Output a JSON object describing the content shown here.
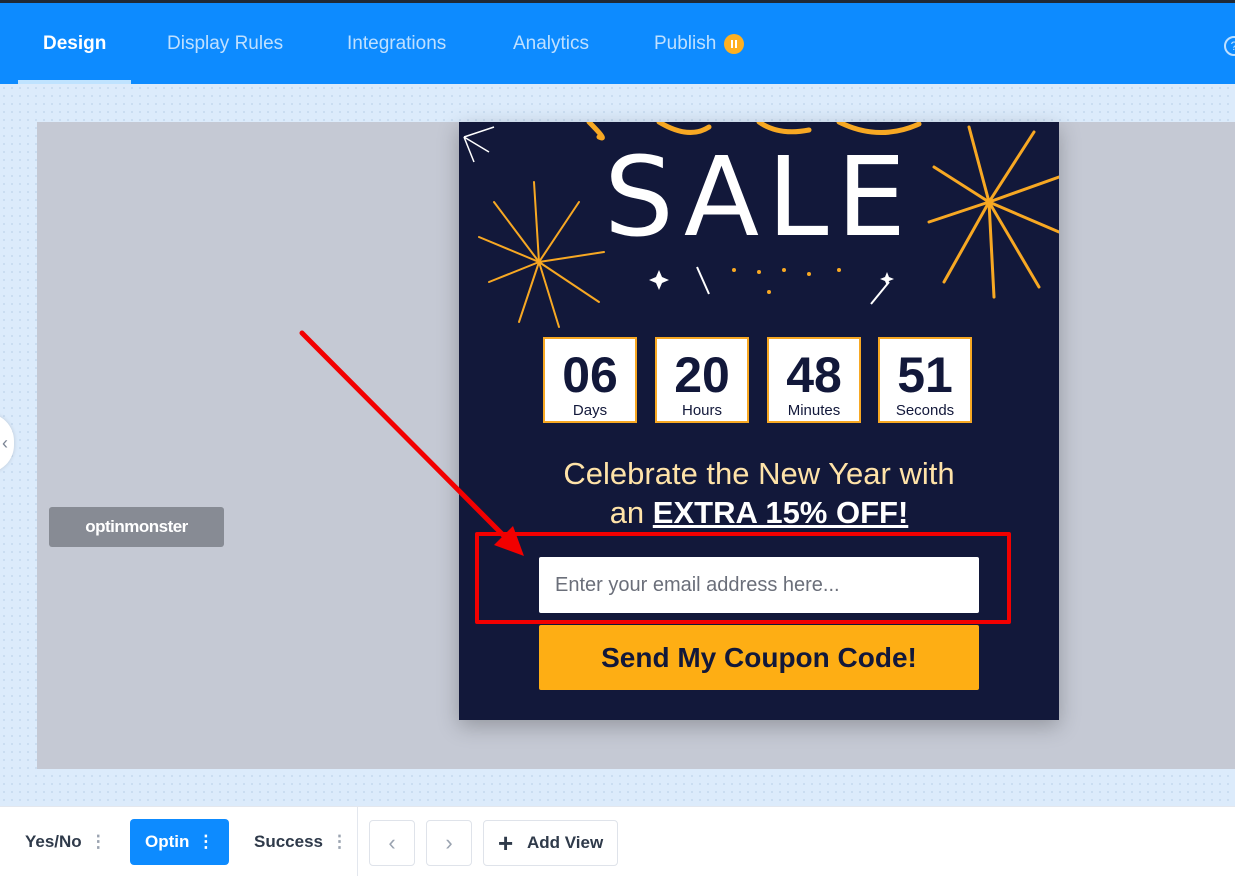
{
  "topbar": {
    "tabs": [
      {
        "label": "Design",
        "active": true
      },
      {
        "label": "Display Rules",
        "active": false
      },
      {
        "label": "Integrations",
        "active": false
      },
      {
        "label": "Analytics",
        "active": false
      },
      {
        "label": "Publish",
        "active": false
      }
    ],
    "publish_status_icon": "pause-icon",
    "help_icon": "help-icon",
    "help_glyph": "?"
  },
  "sidebar": {
    "collapse_icon": "chevron-left-icon",
    "collapse_glyph": "‹"
  },
  "branding": {
    "logo_text": "optinmonster"
  },
  "popup": {
    "headline_script": "New Year",
    "sale_text": "SALE",
    "countdown": [
      {
        "value": "06",
        "label": "Days"
      },
      {
        "value": "20",
        "label": "Hours"
      },
      {
        "value": "48",
        "label": "Minutes"
      },
      {
        "value": "51",
        "label": "Seconds"
      }
    ],
    "headline_line1": "Celebrate the New Year with",
    "headline_line2_prefix": "an ",
    "headline_line2_strong": "EXTRA 15% OFF!",
    "email_placeholder": "Enter your email address here...",
    "button_label": "Send My Coupon Code!"
  },
  "annotation": {
    "color": "#f20000"
  },
  "bottombar": {
    "views": [
      {
        "label": "Yes/No",
        "active": false
      },
      {
        "label": "Optin",
        "active": true
      },
      {
        "label": "Success",
        "active": false
      }
    ],
    "dots_glyph": "⋮",
    "prev_glyph": "‹",
    "next_glyph": "›",
    "plus_glyph": "+",
    "add_view_label": "Add View"
  },
  "colors": {
    "brand_blue": "#0d8bff",
    "popup_bg": "#12183a",
    "accent_orange": "#feae14"
  }
}
